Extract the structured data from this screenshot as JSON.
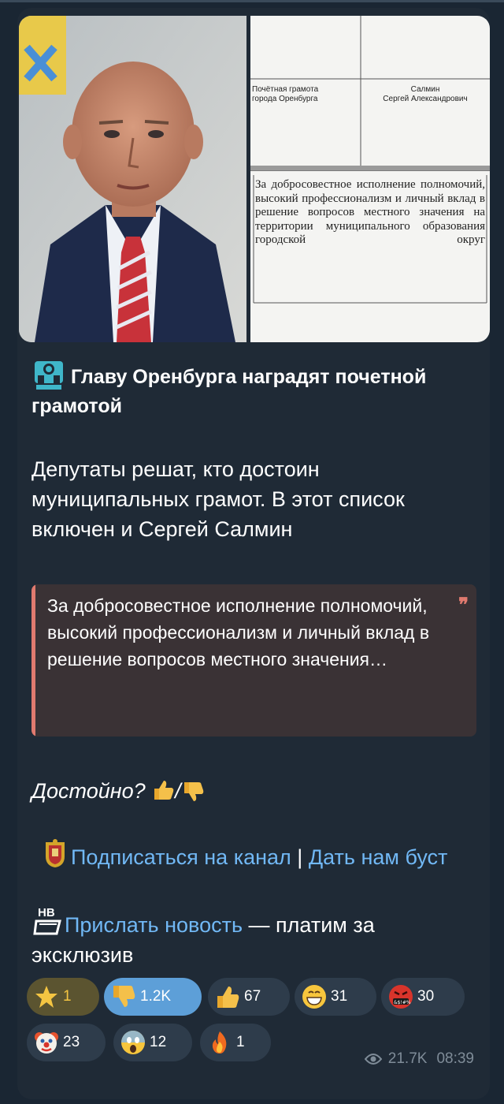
{
  "post": {
    "doc": {
      "cell_award": "Почётная грамота\nгорода Оренбурга",
      "cell_name": "Салмин\nСергей Александрович",
      "body": "За добросовестное исполнение полномочий, высокий профессионализм и личный вклад в решение вопросов местного значения на территории муниципального образования городской округ"
    },
    "title": "Главу Оренбурга наградят почетной грамотой",
    "lead": "Депутаты решат, кто достоин муниципальных грамот. В этот список включен и Сергей Салмин",
    "quote": "За добросовестное исполнение полномочий, высокий профессионализм и личный вклад в решение вопросов местного значения…",
    "question": "Достойно?",
    "question_suffix": "/",
    "subscribe_link": "Подписаться на канал",
    "separator": " | ",
    "boost_link": "Дать нам буст",
    "send_news_link": "Прислать новость",
    "send_news_rest": " — платим за эксклюзив"
  },
  "reactions": [
    {
      "icon": "star-icon",
      "count": "1"
    },
    {
      "icon": "thumbs-down-icon",
      "count": "1.2K"
    },
    {
      "icon": "thumbs-up-icon",
      "count": "67"
    },
    {
      "icon": "grin-icon",
      "count": "31"
    },
    {
      "icon": "angry-cursing-icon",
      "count": "30"
    },
    {
      "icon": "clown-icon",
      "count": "23"
    },
    {
      "icon": "scream-icon",
      "count": "12"
    },
    {
      "icon": "fire-icon",
      "count": "1"
    }
  ],
  "meta": {
    "views": "21.7K",
    "time": "08:39"
  },
  "colors": {
    "link": "#71b8f5",
    "quote_accent": "#e07a6f",
    "active_reaction": "#5d9fd8"
  }
}
